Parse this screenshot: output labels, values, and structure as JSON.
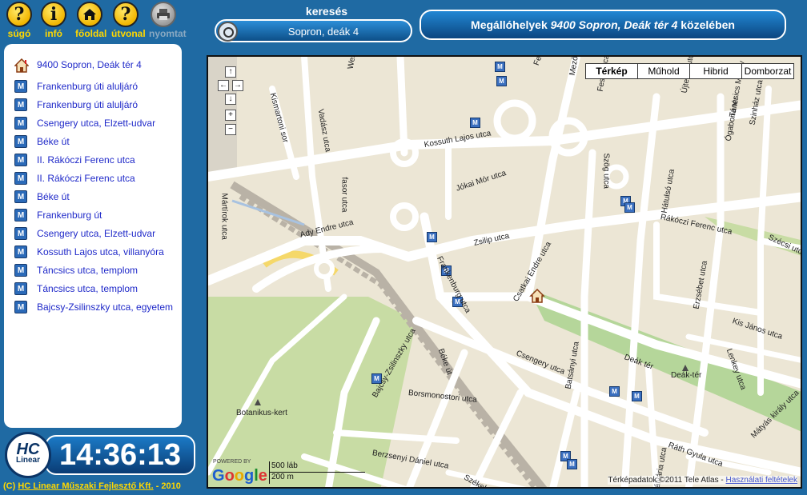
{
  "toolbar": {
    "help": {
      "label": "súgó",
      "glyph": "?"
    },
    "info": {
      "label": "infó",
      "glyph": "i"
    },
    "home": {
      "label": "főoldal"
    },
    "route": {
      "label": "útvonal",
      "glyph": "?"
    },
    "print": {
      "label": "nyomtat"
    }
  },
  "search": {
    "title": "keresés",
    "value": "Sopron, deák 4"
  },
  "header": {
    "prefix": "Megállóhelyek ",
    "address": "9400 Sopron, Deák tér 4",
    "suffix": " közelében"
  },
  "stops": {
    "home": "9400 Sopron, Deák tér 4",
    "items": [
      "Frankenburg úti aluljáró",
      "Frankenburg úti aluljáró",
      "Csengery utca, Elzett-udvar",
      "Béke út",
      "II. Rákóczi Ferenc utca",
      "II. Rákóczi Ferenc utca",
      "Béke út",
      "Frankenburg út",
      "Csengery utca, Elzett-udvar",
      "Kossuth Lajos utca, villanyóra",
      "Táncsics utca, templom",
      "Táncsics utca, templom",
      "Bajcsy-Zsilinszky utca, egyetem"
    ]
  },
  "logo": {
    "text": "HC",
    "sub": "Linear"
  },
  "clock": "14:36:13",
  "footer": {
    "prefix": "(C) ",
    "company": "HC Linear Műszaki Fejlesztő Kft.",
    "suffix": " - 2010"
  },
  "map": {
    "types": [
      "Térkép",
      "Műhold",
      "Hibrid",
      "Domborzat"
    ],
    "selected_type": "Térkép",
    "nav": {
      "up": "↑",
      "left": "←",
      "right": "→",
      "down": "↓",
      "zoom_in": "+",
      "zoom_out": "−"
    },
    "scale": {
      "top": "500 láb",
      "bottom": "200 m"
    },
    "powered": "POWERED BY",
    "google": [
      "G",
      "o",
      "o",
      "g",
      "l",
      "e"
    ],
    "attribution": "Térképadatok ©2011 Tele Atlas - ",
    "terms": "Használati feltételek",
    "marker_glyph": "M",
    "colors": {
      "park": "#c8dca4",
      "road": "#ffffff",
      "block": "#ece6d5",
      "water": "#a8c2e0",
      "yellow_road": "#f5d86a"
    },
    "street_labels": [
      "Kismartoni sor",
      "Vadász utca",
      "Wesselényi utca",
      "Kossuth Lajos utca",
      "fasor utca",
      "Jókai Mór utca",
      "Ferenczy",
      "Mező utca",
      "Festő utca",
      "Újteleki utca",
      "Táncsics Mihály",
      "Ógabona tér",
      "Szinház utca",
      "Szög utca",
      "Hátulsó utca",
      "Rákóczi Ferenc utca",
      "Zsilip utca",
      "Frankenburg utca",
      "Ady Endre utca",
      "Mártírok utca",
      "Csatkai Endre utca",
      "Csengery utca",
      "Deák tér",
      "Erzsébet utca",
      "Kis János utca",
      "Lenkey utca",
      "Béke út",
      "Borsmonostori utca",
      "Batsányi utca",
      "Bajcsy-Zsilinszky utca",
      "Berzsenyi Dániel utca",
      "Székeles utca",
      "Ráth Gyula utca",
      "Mátyás király utca",
      "Botanikus-kert",
      "Deák-tér",
      "Szécsi utca",
      "Kálvária utca"
    ]
  }
}
